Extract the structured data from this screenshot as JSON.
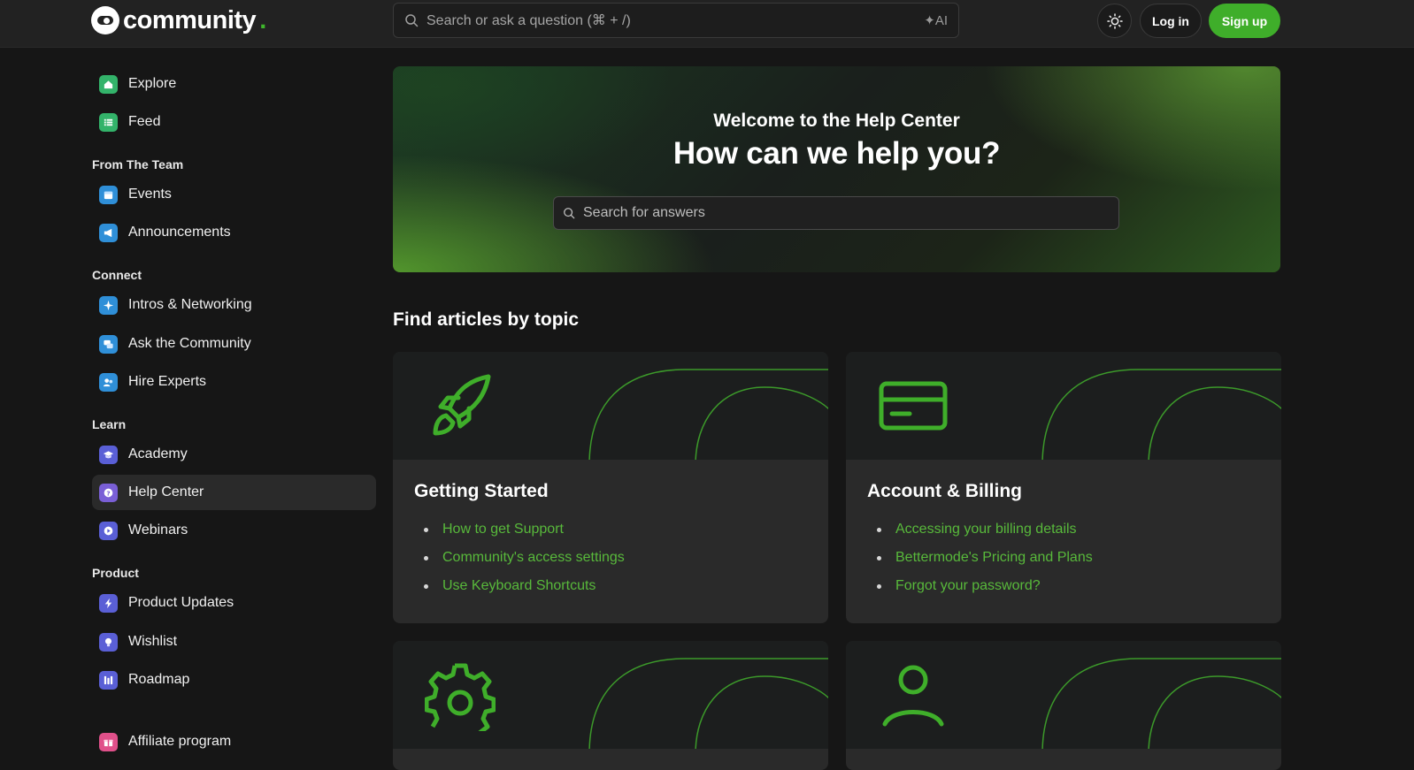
{
  "brand": {
    "name": "community",
    "dot": ".",
    "accent": "#3fae2a"
  },
  "header": {
    "search_placeholder": "Search or ask a question (⌘ + /)",
    "ai_label": "✦AI",
    "login_label": "Log in",
    "signup_label": "Sign up"
  },
  "sidebar": {
    "top": [
      {
        "label": "Explore",
        "icon": "home-icon",
        "color": "#33b36a"
      },
      {
        "label": "Feed",
        "icon": "list-icon",
        "color": "#33b36a"
      }
    ],
    "groups": [
      {
        "heading": "From The Team",
        "items": [
          {
            "label": "Events",
            "icon": "calendar-icon",
            "color": "#2f8fd8"
          },
          {
            "label": "Announcements",
            "icon": "megaphone-icon",
            "color": "#2f8fd8"
          }
        ]
      },
      {
        "heading": "Connect",
        "items": [
          {
            "label": "Intros & Networking",
            "icon": "sparkle-icon",
            "color": "#2f8fd8"
          },
          {
            "label": "Ask the Community",
            "icon": "chat-icon",
            "color": "#2f8fd8"
          },
          {
            "label": "Hire Experts",
            "icon": "users-icon",
            "color": "#2f8fd8"
          }
        ]
      },
      {
        "heading": "Learn",
        "items": [
          {
            "label": "Academy",
            "icon": "graduation-cap-icon",
            "color": "#5a5fd6"
          },
          {
            "label": "Help Center",
            "icon": "question-icon",
            "color": "#7a5fd6",
            "active": true
          },
          {
            "label": "Webinars",
            "icon": "play-icon",
            "color": "#5a5fd6"
          }
        ]
      },
      {
        "heading": "Product",
        "items": [
          {
            "label": "Product Updates",
            "icon": "lightning-icon",
            "color": "#5a5fd6"
          },
          {
            "label": "Wishlist",
            "icon": "lightbulb-icon",
            "color": "#5a5fd6"
          },
          {
            "label": "Roadmap",
            "icon": "columns-icon",
            "color": "#5a5fd6"
          }
        ]
      }
    ],
    "bottom": {
      "label": "Affiliate program",
      "icon": "gift-icon",
      "color": "#e0508a"
    }
  },
  "hero": {
    "subtitle": "Welcome to the Help Center",
    "title": "How can we help you?",
    "search_placeholder": "Search for answers"
  },
  "topics": {
    "title": "Find articles by topic",
    "cards": [
      {
        "title": "Getting Started",
        "icon": "rocket-icon",
        "links": [
          "How to get Support",
          "Community's access settings",
          "Use Keyboard Shortcuts"
        ]
      },
      {
        "title": "Account & Billing",
        "icon": "credit-card-icon",
        "links": [
          "Accessing your billing details",
          "Bettermode's Pricing and Plans",
          "Forgot your password?"
        ]
      },
      {
        "title": "",
        "icon": "gear-icon",
        "links": []
      },
      {
        "title": "",
        "icon": "user-icon",
        "links": []
      }
    ]
  }
}
